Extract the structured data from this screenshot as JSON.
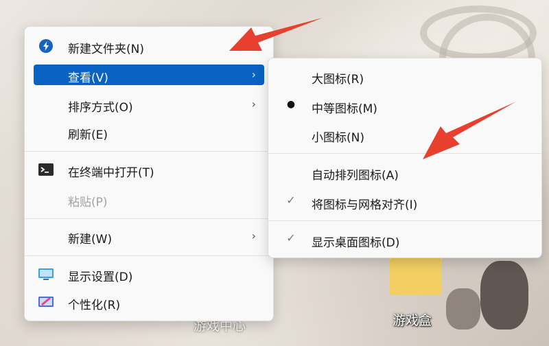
{
  "context_menu": {
    "items": [
      {
        "label": "新建文件夹(N)",
        "icon": "new-folder-icon"
      },
      {
        "label": "查看(V)",
        "submenu": true,
        "highlighted": true
      },
      {
        "label": "排序方式(O)",
        "submenu": true
      },
      {
        "label": "刷新(E)"
      },
      {
        "label": "在终端中打开(T)",
        "icon": "terminal-icon"
      },
      {
        "label": "粘贴(P)",
        "disabled": true
      },
      {
        "label": "新建(W)",
        "submenu": true
      },
      {
        "label": "显示设置(D)",
        "icon": "display-icon"
      },
      {
        "label": "个性化(R)",
        "icon": "personalize-icon"
      }
    ]
  },
  "view_submenu": {
    "items": [
      {
        "label": "大图标(R)"
      },
      {
        "label": "中等图标(M)",
        "state": "bullet"
      },
      {
        "label": "小图标(N)"
      },
      {
        "label": "自动排列图标(A)"
      },
      {
        "label": "将图标与网格对齐(I)",
        "state": "check"
      },
      {
        "label": "显示桌面图标(D)",
        "state": "check"
      }
    ]
  },
  "desktop": {
    "folder_label": "游戏盒",
    "partial_label": "游戏中心"
  },
  "colors": {
    "highlight": "#0a62c2",
    "arrow": "#e8402f",
    "menu_bg": "#f9f9f9"
  }
}
